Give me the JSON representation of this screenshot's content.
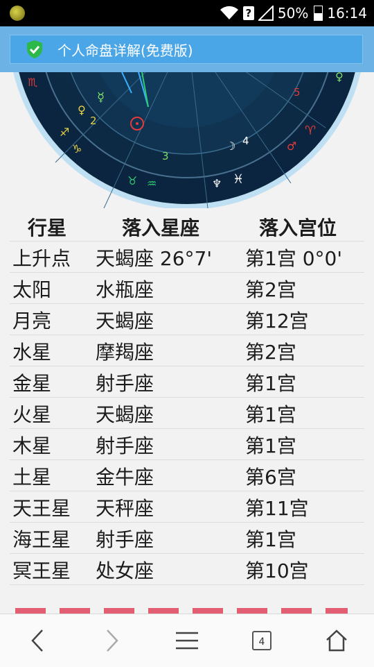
{
  "status_bar": {
    "battery": "50%",
    "time": "16:14",
    "signal_badge": "?"
  },
  "header": {
    "title": "个人命盘详解(免费版)"
  },
  "chart": {
    "house_numbers": [
      "2",
      "3",
      "4",
      "5"
    ],
    "symbols": {
      "scorpio": "♏",
      "mercury": "☿",
      "venus": "♀",
      "sagittarius": "♐",
      "capricorn": "♑",
      "taurus": "♉",
      "aquarius": "♒",
      "neptune": "♆",
      "pisces": "♓",
      "moon": "☽",
      "aries": "♈",
      "mars": "♂"
    }
  },
  "table": {
    "headers": [
      "行星",
      "落入星座",
      "落入宫位"
    ],
    "rows": [
      [
        "上升点",
        "天蝎座 26°7'",
        "第1宫 0°0'"
      ],
      [
        "太阳",
        "水瓶座",
        "第2宫"
      ],
      [
        "月亮",
        "天蝎座",
        "第12宫"
      ],
      [
        "水星",
        "摩羯座",
        "第2宫"
      ],
      [
        "金星",
        "射手座",
        "第1宫"
      ],
      [
        "火星",
        "天蝎座",
        "第1宫"
      ],
      [
        "木星",
        "射手座",
        "第1宫"
      ],
      [
        "土星",
        "金牛座",
        "第6宫"
      ],
      [
        "天王星",
        "天秤座",
        "第11宫"
      ],
      [
        "海王星",
        "射手座",
        "第1宫"
      ],
      [
        "冥王星",
        "处女座",
        "第10宫"
      ]
    ]
  },
  "bottom_nav": {
    "tab_count": "4"
  },
  "colors": {
    "header_bg": "#6cb2e4",
    "titlebar_bg": "#4aa6e6",
    "chart_dark": "#0c2a44",
    "accent_red": "#e0445b"
  }
}
